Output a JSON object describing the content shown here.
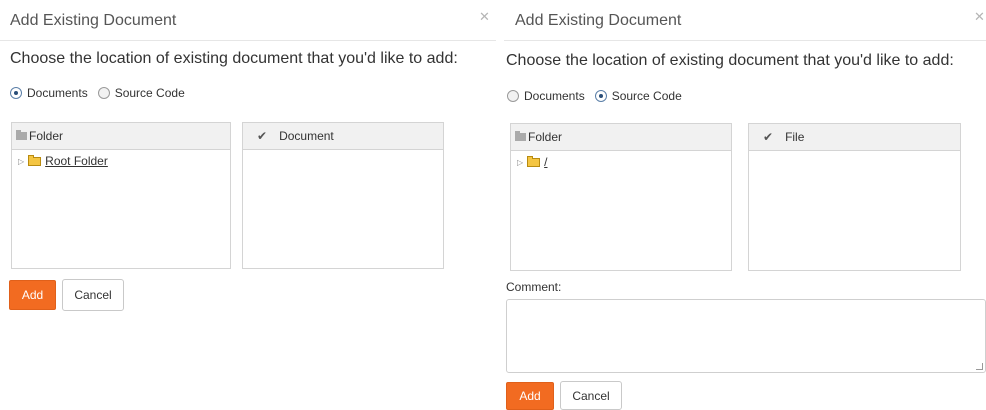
{
  "left_dialog": {
    "title": "Add Existing Document",
    "close_icon": "close-icon",
    "prompt": "Choose the location of existing document that you'd like to add:",
    "radios": [
      {
        "label": "Documents",
        "checked": true
      },
      {
        "label": "Source Code",
        "checked": false
      }
    ],
    "folder_panel": {
      "header": "Folder",
      "items": [
        {
          "label": "Root Folder"
        }
      ]
    },
    "selection_panel": {
      "header": "Document"
    },
    "add_label": "Add",
    "cancel_label": "Cancel"
  },
  "right_dialog": {
    "title": "Add Existing Document",
    "close_icon": "close-icon",
    "prompt": "Choose the location of existing document that you'd like to add:",
    "radios": [
      {
        "label": "Documents",
        "checked": false
      },
      {
        "label": "Source Code",
        "checked": true
      }
    ],
    "folder_panel": {
      "header": "Folder",
      "items": [
        {
          "label": "/"
        }
      ]
    },
    "selection_panel": {
      "header": "File"
    },
    "comment_label": "Comment:",
    "comment_value": "",
    "add_label": "Add",
    "cancel_label": "Cancel"
  },
  "colors": {
    "accent": "#f26b21",
    "panel_header": "#f1f1f1",
    "folder": "#f4c542"
  }
}
